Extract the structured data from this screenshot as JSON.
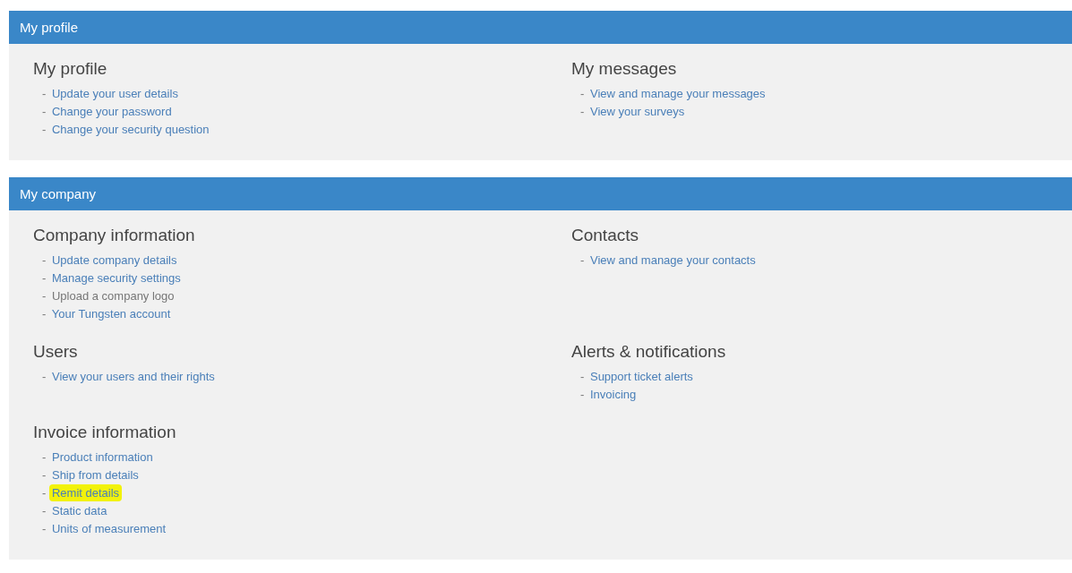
{
  "panels": [
    {
      "title": "My profile",
      "sections": [
        {
          "title": "My profile",
          "links": [
            {
              "bullet": "-",
              "label": "Update your user details",
              "disabled": false,
              "highlighted": false
            },
            {
              "bullet": "-",
              "label": "Change your password",
              "disabled": false,
              "highlighted": false
            },
            {
              "bullet": "-",
              "label": "Change your security question",
              "disabled": false,
              "highlighted": false
            }
          ]
        },
        {
          "title": "My messages",
          "links": [
            {
              "bullet": "-",
              "label": "View and manage your messages",
              "disabled": false,
              "highlighted": false
            },
            {
              "bullet": "-",
              "label": "View your surveys",
              "disabled": false,
              "highlighted": false
            }
          ]
        }
      ]
    },
    {
      "title": "My company",
      "sections": [
        {
          "title": "Company information",
          "links": [
            {
              "bullet": "-",
              "label": "Update company details",
              "disabled": false,
              "highlighted": false
            },
            {
              "bullet": "-",
              "label": "Manage security settings",
              "disabled": false,
              "highlighted": false
            },
            {
              "bullet": "-",
              "label": "Upload a company logo",
              "disabled": true,
              "highlighted": false
            },
            {
              "bullet": "-",
              "label": "Your Tungsten account",
              "disabled": false,
              "highlighted": false
            }
          ]
        },
        {
          "title": "Contacts",
          "links": [
            {
              "bullet": "-",
              "label": "View and manage your contacts",
              "disabled": false,
              "highlighted": false
            }
          ]
        },
        {
          "title": "Users",
          "links": [
            {
              "bullet": "-",
              "label": "View your users and their rights",
              "disabled": false,
              "highlighted": false
            }
          ]
        },
        {
          "title": "Alerts & notifications",
          "links": [
            {
              "bullet": "-",
              "label": "Support ticket alerts",
              "disabled": false,
              "highlighted": false
            },
            {
              "bullet": "-",
              "label": "Invoicing",
              "disabled": false,
              "highlighted": false
            }
          ]
        },
        {
          "title": "Invoice information",
          "links": [
            {
              "bullet": "-",
              "label": "Product information",
              "disabled": false,
              "highlighted": false
            },
            {
              "bullet": "-",
              "label": "Ship from details",
              "disabled": false,
              "highlighted": false
            },
            {
              "bullet": "-",
              "label": "Remit details",
              "disabled": false,
              "highlighted": true
            },
            {
              "bullet": "-",
              "label": "Static data",
              "disabled": false,
              "highlighted": false
            },
            {
              "bullet": "-",
              "label": "Units of measurement",
              "disabled": false,
              "highlighted": false
            }
          ]
        }
      ]
    }
  ]
}
